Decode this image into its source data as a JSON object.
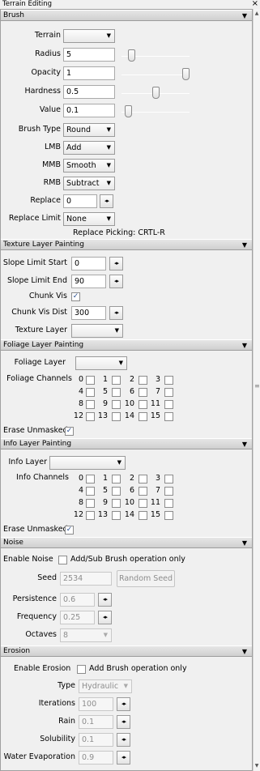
{
  "window": {
    "title": "Terrain Editing",
    "close": "×"
  },
  "sections": {
    "brush": "Brush",
    "texture": "Texture Layer Painting",
    "foliage": "Foliage Layer Painting",
    "info": "Info Layer Painting",
    "noise": "Noise",
    "erosion": "Erosion",
    "arrow": "▼"
  },
  "brush": {
    "terrain_label": "Terrain",
    "terrain_value": "",
    "radius_label": "Radius",
    "radius_value": "5",
    "radius_level": 0.1,
    "opacity_label": "Opacity",
    "opacity_value": "1",
    "opacity_level": 1.0,
    "hardness_label": "Hardness",
    "hardness_value": "0.5",
    "hardness_level": 0.5,
    "value_label": "Value",
    "value_value": "0.1",
    "value_level": 0.05,
    "brush_type_label": "Brush Type",
    "brush_type_value": "Round",
    "lmb_label": "LMB",
    "lmb_value": "Add",
    "mmb_label": "MMB",
    "mmb_value": "Smooth",
    "rmb_label": "RMB",
    "rmb_value": "Subtract",
    "replace_label": "Replace",
    "replace_value": "0",
    "replace_limit_label": "Replace Limit",
    "replace_limit_value": "None",
    "replace_picking": "Replace Picking: CRTL-R"
  },
  "texture": {
    "slope_start_label": "Slope Limit Start",
    "slope_start_value": "0",
    "slope_end_label": "Slope Limit End",
    "slope_end_value": "90",
    "chunk_vis_label": "Chunk Vis",
    "chunk_vis_checked": true,
    "chunk_vis_dist_label": "Chunk Vis Dist",
    "chunk_vis_dist_value": "300",
    "texture_layer_label": "Texture Layer",
    "texture_layer_value": ""
  },
  "foliage": {
    "layer_label": "Foliage Layer",
    "layer_value": "",
    "channels_label": "Foliage Channels",
    "channels": [
      "0",
      "1",
      "2",
      "3",
      "4",
      "5",
      "6",
      "7",
      "8",
      "9",
      "10",
      "11",
      "12",
      "13",
      "14",
      "15"
    ],
    "erase_label": "Erase Unmasked",
    "erase_checked": true
  },
  "info": {
    "layer_label": "Info Layer",
    "layer_value": "",
    "channels_label": "Info Channels",
    "channels": [
      "0",
      "1",
      "2",
      "3",
      "4",
      "5",
      "6",
      "7",
      "8",
      "9",
      "10",
      "11",
      "12",
      "13",
      "14",
      "15"
    ],
    "erase_label": "Erase Unmasked",
    "erase_checked": true
  },
  "noise": {
    "enable_label": "Enable Noise",
    "enable_checked": false,
    "addsub_label": "Add/Sub Brush operation only",
    "seed_label": "Seed",
    "seed_value": "2534",
    "random_seed": "Random Seed",
    "persistence_label": "Persistence",
    "persistence_value": "0.6",
    "frequency_label": "Frequency",
    "frequency_value": "0.25",
    "octaves_label": "Octaves",
    "octaves_value": "8"
  },
  "erosion": {
    "enable_label": "Enable Erosion",
    "enable_checked": false,
    "add_label": "Add Brush operation only",
    "type_label": "Type",
    "type_value": "Hydraulic",
    "iterations_label": "Iterations",
    "iterations_value": "100",
    "rain_label": "Rain",
    "rain_value": "0.1",
    "solubility_label": "Solubility",
    "solubility_value": "0.1",
    "water_evap_label": "Water Evaporation",
    "water_evap_value": "0.9"
  },
  "icons": {
    "dropdown": "▼",
    "spin": "◂▸",
    "check": "✓",
    "scroll_up": "▲",
    "scroll_down": "▼",
    "grip": "≡"
  }
}
